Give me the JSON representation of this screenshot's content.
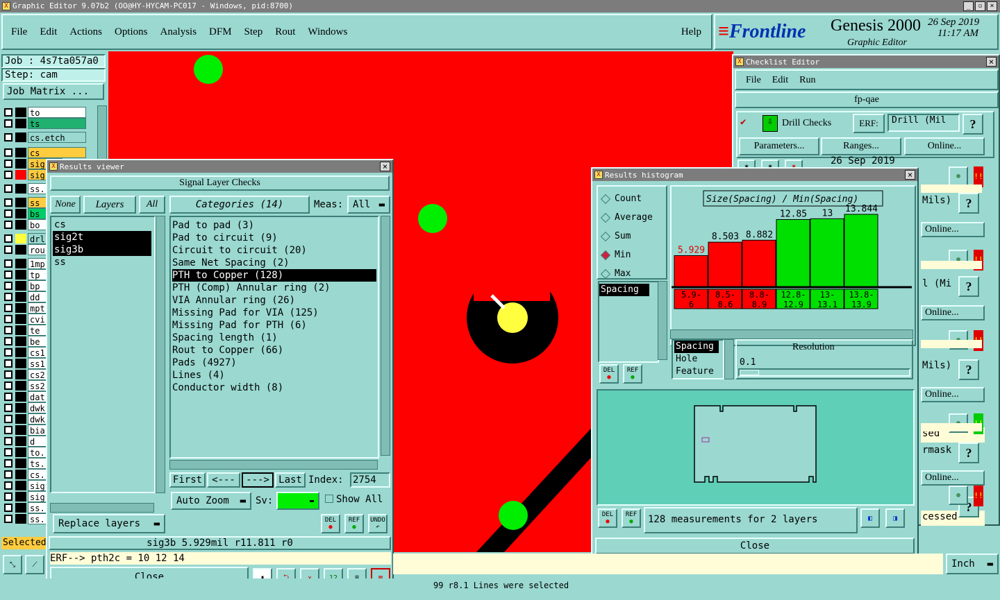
{
  "app": {
    "title": "Graphic Editor 9.07b2 (OO@HY-HYCAM-PC017 - Windows, pid:8700)",
    "menu": [
      "File",
      "Edit",
      "Actions",
      "Options",
      "Analysis",
      "DFM",
      "Step",
      "Rout",
      "Windows"
    ],
    "help": "Help",
    "brand": "Frontline",
    "product": "Genesis 2000",
    "subtitle": "Graphic Editor",
    "date": "26 Sep 2019",
    "time": "11:17 AM"
  },
  "left": {
    "job": "Job : 4s7ta057a0",
    "step": "Step: cam",
    "job_matrix": "Job Matrix ...",
    "layers": [
      "to",
      "ts",
      "cs.etch",
      "cs",
      "sig",
      "sig",
      "ss.",
      "ss",
      "bs",
      "bo",
      "drl",
      "rou",
      "1mp",
      "tp",
      "bp",
      "dd",
      "mpt",
      "cvi",
      "te",
      "be",
      "cs1",
      "ss1",
      "cs2",
      "ss2",
      "dat",
      "dwk",
      "dwk",
      "bia",
      "d",
      "to.",
      "ts.",
      "cs.",
      "sig",
      "sig",
      "ss.",
      "ss."
    ],
    "selected": "Selected"
  },
  "results_viewer": {
    "title": "Results viewer",
    "header": "Signal Layer Checks",
    "none": "None",
    "layers_label": "Layers",
    "all": "All",
    "layer_list": [
      "cs",
      "sig2t",
      "sig3b",
      "ss"
    ],
    "categories_label": "Categories (14)",
    "meas_label": "Meas:",
    "meas_value": "All",
    "categories": [
      "Pad to pad (3)",
      "Pad to circuit (9)",
      "Circuit to circuit (20)",
      "Same Net Spacing (2)",
      "PTH to Copper (128)",
      "PTH (Comp) Annular ring (2)",
      "VIA Annular ring (26)",
      "Missing Pad for VIA (125)",
      "Missing Pad for PTH (6)",
      "Spacing length (1)",
      "Rout to Copper (66)",
      "Pads (4927)",
      "Lines (4)",
      "Conductor width (8)"
    ],
    "first": "First",
    "prev": "<---",
    "next": "--->",
    "last": "Last",
    "index_label": "Index:",
    "index_value": "2754",
    "auto_zoom": "Auto Zoom",
    "sv": "Sv:",
    "show_all": "Show All",
    "replace_layers": "Replace layers",
    "del": "DEL",
    "ref": "REF",
    "undo": "UNDO",
    "status": "sig3b 5.929mil  r11.811  r0",
    "erf": "ERF--> pth2c = 10 12 14",
    "close": "Close"
  },
  "checklist": {
    "title": "Checklist Editor",
    "menu": [
      "File",
      "Edit",
      "Run"
    ],
    "name": "fp-qae",
    "drill_checks": "Drill Checks",
    "erf_label": "ERF:",
    "erf_value": "Drill (Mil",
    "parameters": "Parameters...",
    "ranges": "Ranges...",
    "online": "Online...",
    "date": "26 Sep 2019",
    "partials": [
      "Mils)",
      "Online...",
      "l (Mi",
      "Online...",
      "Mils)",
      "Online...",
      "sed",
      "rmask",
      "Online...",
      "cessed"
    ],
    "question": "?",
    "bang": "!!"
  },
  "histogram": {
    "title": "Results histogram",
    "options": [
      "Count",
      "Average",
      "Sum",
      "Min",
      "Max"
    ],
    "selected_option": "Min",
    "metric_list": [
      "Spacing"
    ],
    "chart_title": "Size(Spacing) / Min(Spacing)",
    "del": "DEL",
    "ref": "REF",
    "res_list": [
      "Spacing",
      "Hole",
      "Feature"
    ],
    "resolution_label": "Resolution",
    "resolution_value": "0.1",
    "summary": "128 measurements for 2 layers",
    "close": "Close"
  },
  "chart_data": {
    "type": "bar",
    "title": "Size(Spacing) / Min(Spacing)",
    "categories": [
      "5.9-6",
      "8.5-8.6",
      "8.8-8.9",
      "12.8-12.9",
      "13-13.1",
      "13.8-13.9"
    ],
    "values": [
      5.929,
      8.503,
      8.882,
      12.85,
      13,
      13.844
    ],
    "labels": [
      "5.929",
      "8.503",
      "8.882",
      "12.85",
      "13",
      "13.844"
    ],
    "colors": [
      "#ff0000",
      "#ff0000",
      "#ff0000",
      "#00e000",
      "#00e000",
      "#00e000"
    ],
    "ylim": [
      0,
      13.844
    ]
  },
  "bottom": {
    "units": "Inch",
    "message": "99 r8.1 Lines were selected"
  },
  "colors": {
    "bg": "#9ad8d0",
    "red": "#ff0000",
    "green": "#00ee00",
    "yellow": "#ffff40"
  }
}
